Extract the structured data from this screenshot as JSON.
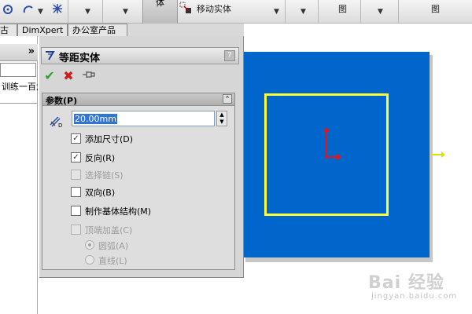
{
  "toolbar": {
    "active_button_label": "体",
    "move_entity_label": "移动实体",
    "right_label_1": "图",
    "right_label_2": "图"
  },
  "tabs": [
    {
      "label": "古"
    },
    {
      "label": "DimXpert"
    },
    {
      "label": "办公室产品"
    }
  ],
  "left_panel": {
    "collapse_glyph": "»",
    "tree_text": "训练一百六"
  },
  "property_manager": {
    "title": "等距实体",
    "help_glyph": "?",
    "ok_glyph": "✔",
    "cancel_glyph": "✖",
    "group": {
      "title": "参数(P)",
      "collapse_glyph": "⌃",
      "distance_value": "20.00mm",
      "checkboxes": [
        {
          "label": "添加尺寸(D)",
          "checked": true,
          "enabled": true
        },
        {
          "label": "反向(R)",
          "checked": true,
          "enabled": true
        },
        {
          "label": "选择链(S)",
          "checked": false,
          "enabled": false
        },
        {
          "label": "双向(B)",
          "checked": false,
          "enabled": true
        },
        {
          "label": "制作基体结构(M)",
          "checked": false,
          "enabled": true
        },
        {
          "label": "顶端加盖(C)",
          "checked": false,
          "enabled": false
        }
      ],
      "radios": [
        {
          "label": "圆弧(A)",
          "selected": true
        },
        {
          "label": "直线(L)",
          "selected": false
        }
      ]
    }
  },
  "graphics": {
    "background_color": "#0066cc",
    "sketch_color": "#ffff33",
    "origin_color": "#ee1111"
  },
  "watermark": {
    "main": "Bai 经验",
    "sub": "jingyan.baidu.com"
  }
}
